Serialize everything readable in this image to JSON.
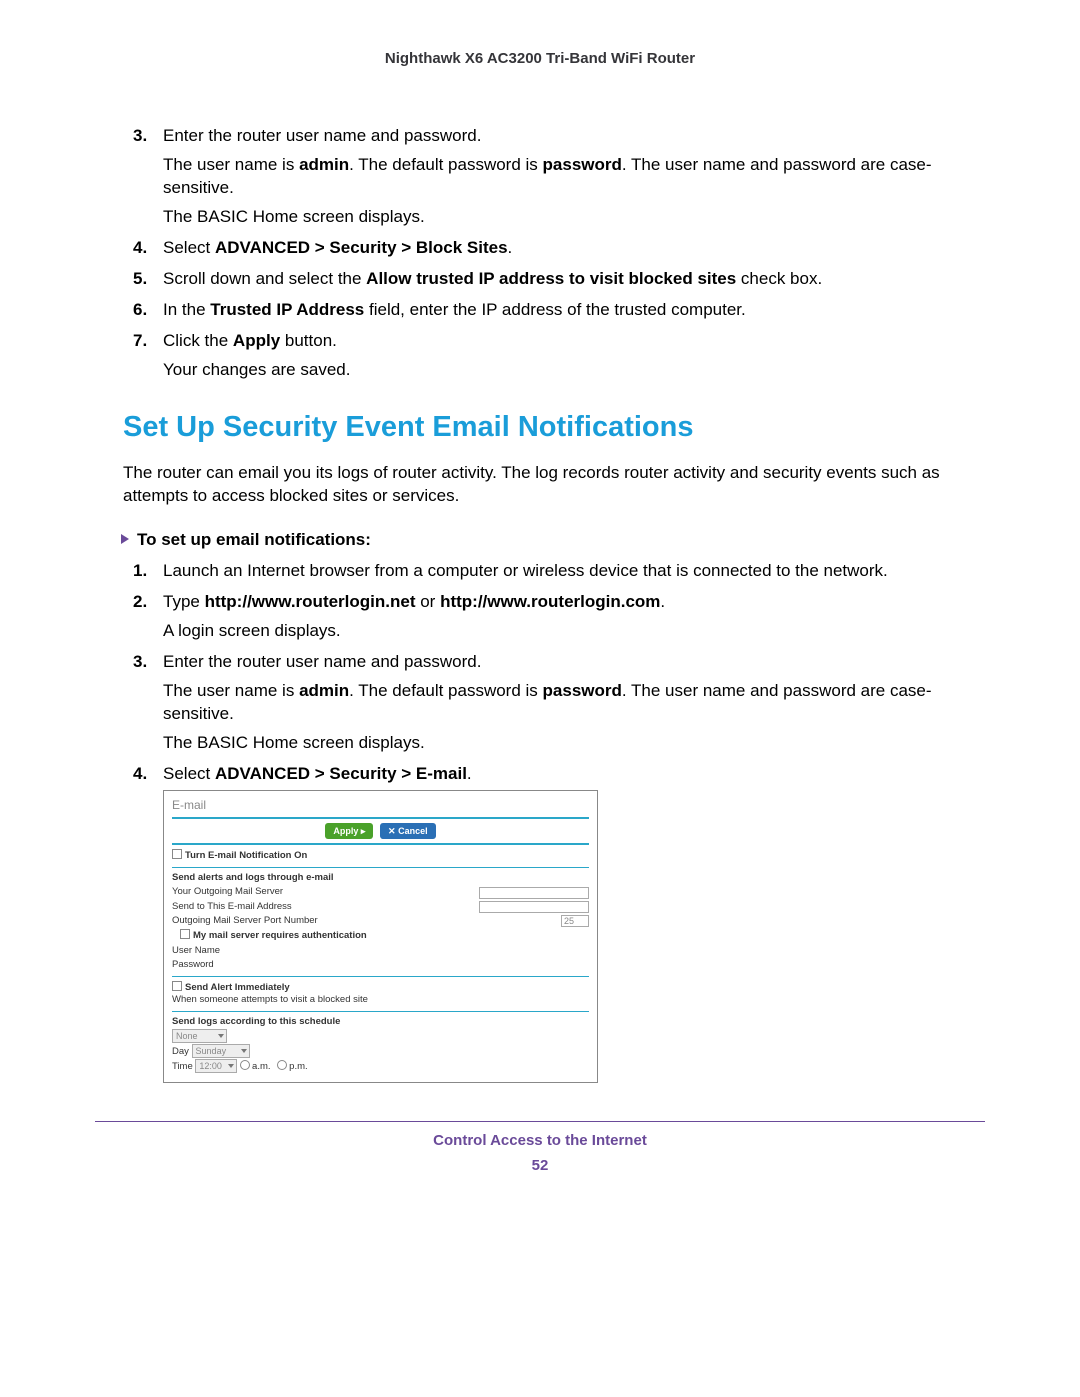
{
  "header": "Nighthawk X6 AC3200 Tri-Band WiFi Router",
  "steps1": {
    "s3_a": "Enter the router user name and password.",
    "s3_b_pre": "The user name is ",
    "s3_b_b1": "admin",
    "s3_b_mid": ". The default password is ",
    "s3_b_b2": "password",
    "s3_b_post": ". The user name and password are case-sensitive.",
    "s3_c": "The BASIC Home screen displays.",
    "s4_pre": "Select ",
    "s4_bold": "ADVANCED > Security > Block Sites",
    "s4_post": ".",
    "s5_pre": "Scroll down and select the ",
    "s5_bold": "Allow trusted IP address to visit blocked sites",
    "s5_post": " check box.",
    "s6_pre": "In the ",
    "s6_bold": "Trusted IP Address",
    "s6_post": " field, enter the IP address of the trusted computer.",
    "s7_pre": "Click the ",
    "s7_bold": "Apply",
    "s7_post": " button.",
    "s7_b": "Your changes are saved."
  },
  "section_title": "Set Up Security Event Email Notifications",
  "intro": "The router can email you its logs of router activity. The log records router activity and security events such as attempts to access blocked sites or services.",
  "proc_title": "To set up email notifications:",
  "steps2": {
    "s1": "Launch an Internet browser from a computer or wireless device that is connected to the network.",
    "s2_pre": "Type ",
    "s2_b1": "http://www.routerlogin.net",
    "s2_mid": " or ",
    "s2_b2": "http://www.routerlogin.com",
    "s2_post": ".",
    "s2_sub": "A login screen displays.",
    "s3_a": "Enter the router user name and password.",
    "s3_b_pre": "The user name is ",
    "s3_b_b1": "admin",
    "s3_b_mid": ". The default password is ",
    "s3_b_b2": "password",
    "s3_b_post": ". The user name and password are case-sensitive.",
    "s3_c": "The BASIC Home screen displays.",
    "s4_pre": "Select ",
    "s4_bold": "ADVANCED > Security > E-mail",
    "s4_post": "."
  },
  "shot": {
    "title": "E-mail",
    "apply": "Apply ▸",
    "cancel": "✕ Cancel",
    "turn_on": "Turn E-mail Notification On",
    "send_alerts": "Send alerts and logs through e-mail",
    "outgoing": "Your Outgoing Mail Server",
    "send_to": "Send to This E-mail Address",
    "port": "Outgoing Mail Server Port Number",
    "port_val": "25",
    "auth": "My mail server requires authentication",
    "user": "User Name",
    "pass": "Password",
    "alert_imm": "Send Alert Immediately",
    "alert_sub": "When someone attempts to visit a blocked site",
    "sched": "Send logs according to this schedule",
    "sched_sel": "None",
    "day_label": "Day",
    "day_sel": "Sunday",
    "time_label": "Time",
    "time_sel": "12:00",
    "am": "a.m.",
    "pm": "p.m."
  },
  "footer_title": "Control Access to the Internet",
  "footer_page": "52"
}
